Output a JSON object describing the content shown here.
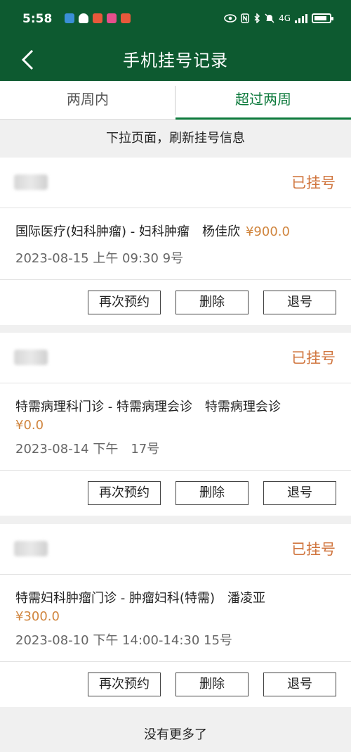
{
  "status_bar": {
    "time": "5:58",
    "network": "4G",
    "left_icons": [
      "notification-blue-icon",
      "heart-icon",
      "app-red-icon",
      "app-pink-icon",
      "app-red-icon"
    ],
    "right_icons": [
      "eye-icon",
      "nfc-icon",
      "bluetooth-icon",
      "mute-icon",
      "signal-icon",
      "battery-icon"
    ],
    "battery_level": 0.85
  },
  "nav": {
    "title": "手机挂号记录"
  },
  "tabs": [
    {
      "label": "两周内",
      "active": false
    },
    {
      "label": "超过两周",
      "active": true
    }
  ],
  "refresh_hint": "下拉页面，刷新挂号信息",
  "records": [
    {
      "status": "已挂号",
      "title": "国际医疗(妇科肿瘤) - 妇科肿瘤　杨佳欣",
      "price": "¥900.0",
      "time": "2023-08-15 上午 09:30 9号"
    },
    {
      "status": "已挂号",
      "title": "特需病理科门诊 - 特需病理会诊　特需病理会诊",
      "price": "¥0.0",
      "time": "2023-08-14 下午　17号"
    },
    {
      "status": "已挂号",
      "title": "特需妇科肿瘤门诊 - 肿瘤妇科(特需)　潘凌亚",
      "price": "¥300.0",
      "time": "2023-08-10 下午 14:00-14:30 15号"
    }
  ],
  "actions": {
    "rebook": "再次预约",
    "delete": "删除",
    "cancel": "退号"
  },
  "footer": "没有更多了",
  "colors": {
    "header": "#0d5a30",
    "accent_green": "#0d7a3c",
    "status_orange": "#d0753e",
    "price_orange": "#d0853e"
  }
}
